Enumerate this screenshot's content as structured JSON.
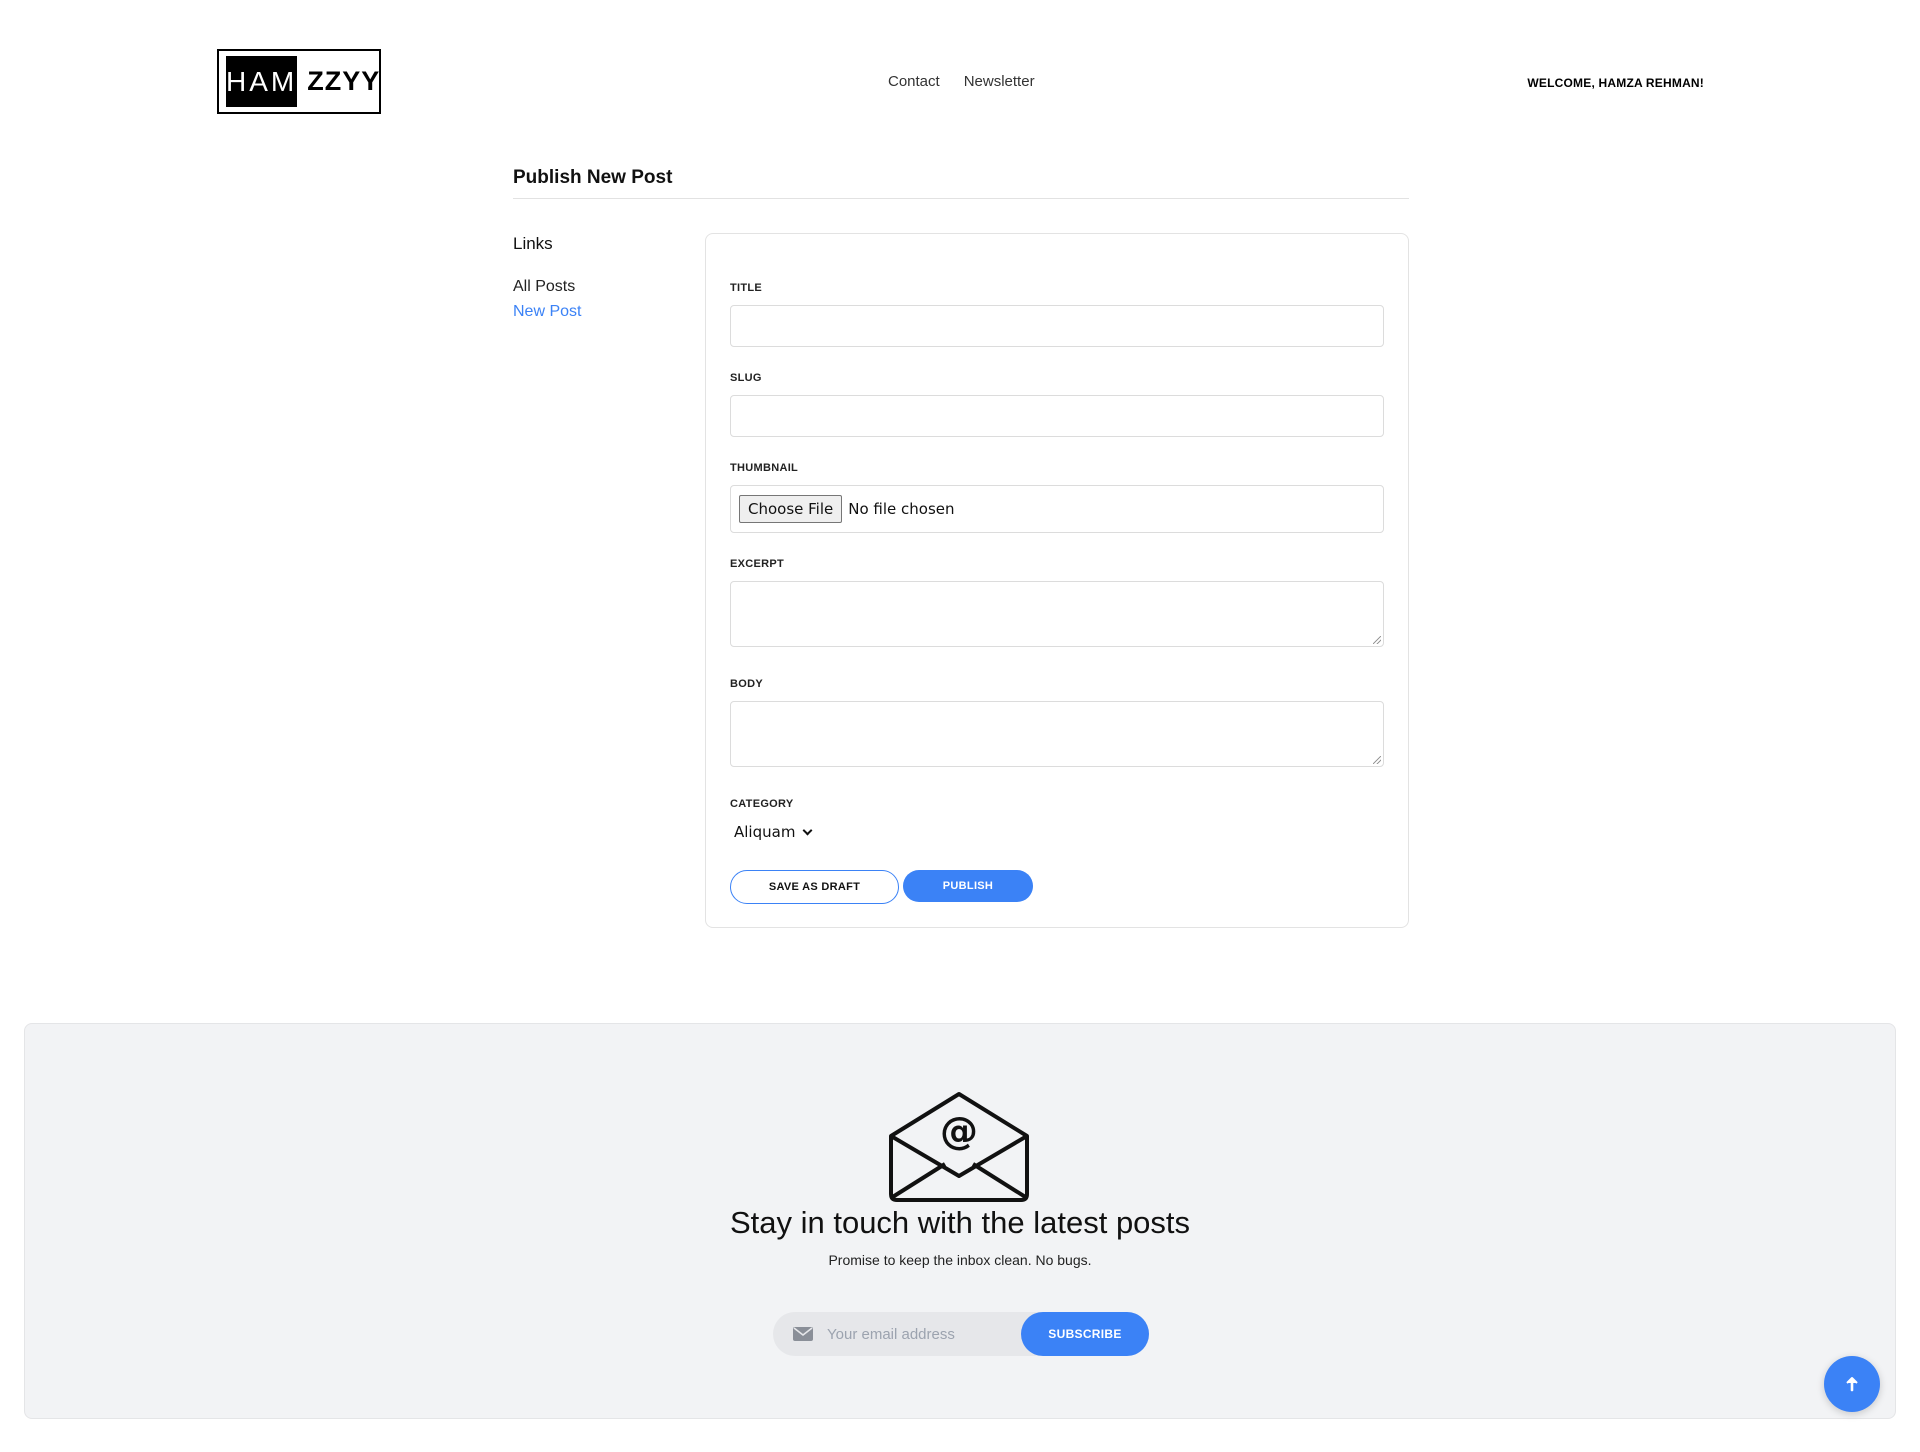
{
  "logo": {
    "left": "HAM",
    "right": "ZZYY"
  },
  "nav": {
    "items": [
      "Contact",
      "Newsletter"
    ]
  },
  "welcome": "WELCOME, HAMZA REHMAN!",
  "main": {
    "title": "Publish New Post",
    "sidebar": {
      "heading": "Links",
      "links": [
        {
          "label": "All Posts",
          "active": false
        },
        {
          "label": "New Post",
          "active": true
        }
      ]
    },
    "form": {
      "title_label": "TITLE",
      "title_value": "",
      "slug_label": "SLUG",
      "slug_value": "",
      "thumbnail_label": "THUMBNAIL",
      "file_button": "Choose File",
      "file_status": "No file chosen",
      "excerpt_label": "EXCERPT",
      "body_label": "BODY",
      "category_label": "CATEGORY",
      "category_value": "Aliquam",
      "draft_button": "SAVE AS DRAFT",
      "publish_button": "PUBLISH"
    }
  },
  "newsletter": {
    "icon": "envelope-at-icon",
    "title": "Stay in touch with the latest posts",
    "subtitle": "Promise to keep the inbox clean. No bugs.",
    "email_placeholder": "Your email address",
    "subscribe_button": "SUBSCRIBE"
  },
  "scroll_top": {
    "icon": "arrow-up-icon"
  },
  "colors": {
    "accent": "#3b82f6",
    "footer_bg": "#f2f3f5"
  }
}
